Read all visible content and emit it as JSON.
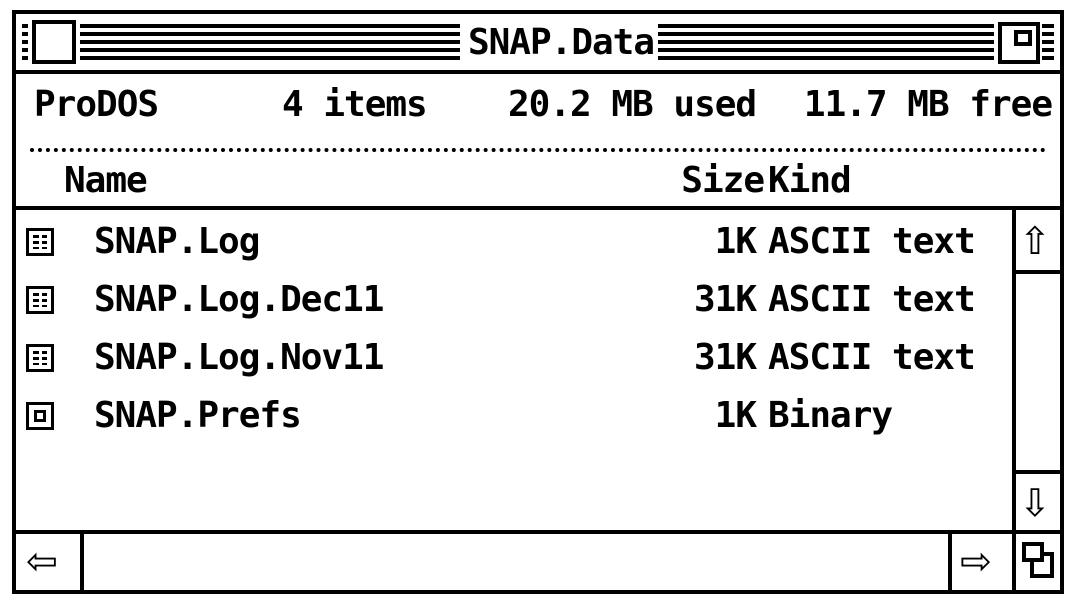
{
  "window": {
    "title": "SNAP.Data"
  },
  "info": {
    "volume": "ProDOS",
    "items": "4 items",
    "used": "20.2 MB used",
    "free": "11.7 MB free"
  },
  "columns": {
    "name": "Name",
    "size": "Size",
    "kind": "Kind"
  },
  "files": [
    {
      "name": "SNAP.Log",
      "size": "1K",
      "kind": "ASCII text",
      "icon": "text-document-icon"
    },
    {
      "name": "SNAP.Log.Dec11",
      "size": "31K",
      "kind": "ASCII text",
      "icon": "text-document-icon"
    },
    {
      "name": "SNAP.Log.Nov11",
      "size": "31K",
      "kind": "ASCII text",
      "icon": "text-document-icon"
    },
    {
      "name": "SNAP.Prefs",
      "size": "1K",
      "kind": "Binary",
      "icon": "binary-document-icon"
    }
  ],
  "icons": {
    "close": "close-box-icon",
    "zoom": "zoom-box-icon",
    "scroll_up": "scroll-up-arrow-icon",
    "scroll_down": "scroll-down-arrow-icon",
    "scroll_left": "scroll-left-arrow-icon",
    "scroll_right": "scroll-right-arrow-icon",
    "grow": "grow-box-icon"
  }
}
